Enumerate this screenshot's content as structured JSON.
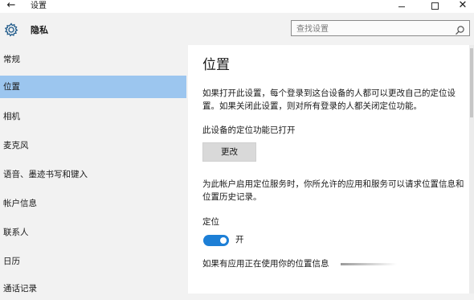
{
  "window": {
    "title": "设置",
    "back_glyph": "←",
    "close_glyph": "✕"
  },
  "header": {
    "title": "隐私"
  },
  "search": {
    "placeholder": "查找设置"
  },
  "sidebar": {
    "selected_index": 1,
    "items": [
      {
        "label": "常规"
      },
      {
        "label": "位置"
      },
      {
        "label": "相机"
      },
      {
        "label": "麦克风"
      },
      {
        "label": "语音、墨迹书写和键入"
      },
      {
        "label": "帐户信息"
      },
      {
        "label": "联系人"
      },
      {
        "label": "日历"
      },
      {
        "label": "通话记录"
      }
    ]
  },
  "content": {
    "title": "位置",
    "description": "如果打开此设置，每个登录到这台设备的人都可以更改自己的定位设置。如果关闭此设置，则对所有登录的人都关闭定位功能。",
    "device_status": "此设备的定位功能已打开",
    "change_button": "更改",
    "service_description": "为此帐户启用定位服务时，你所允许的应用和服务可以请求位置信息和位置历史记录。",
    "location_label": "定位",
    "location_toggle_state": "开",
    "location_toggle_on": true,
    "in_use_text": "如果有应用正在使用你的位置信息"
  },
  "colors": {
    "selected_nav": "#9cc6ef",
    "toggle_on": "#1d7fd6",
    "button_bg": "#d9d9d9",
    "window_bg": "#f2f2f2",
    "content_bg": "#ffffff"
  }
}
